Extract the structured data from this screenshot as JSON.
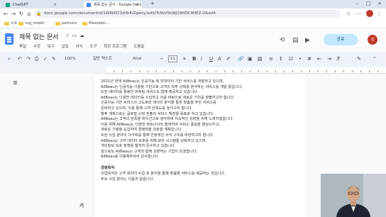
{
  "browser": {
    "tabs": [
      {
        "label": "ChatGPT",
        "favicon_color": "#10a37f"
      },
      {
        "label": "제목 없는 문서 - Google Docs",
        "favicon_color": "#4285f4"
      }
    ],
    "url": "docs.google.com/document/d/1W4kN73zHk4/Zgwcy/edit/TcfwV5kWJ19HOC4HEZ-U&edit",
    "bookmarks": [
      "노트",
      "nsg_model",
      "partners",
      "Mastodon..."
    ]
  },
  "docs": {
    "title": "제목 없는 문서",
    "menu": [
      "파일",
      "수정",
      "보기",
      "삽입",
      "서식",
      "도구",
      "확장 프로그램",
      "도움말"
    ],
    "zoom": "100%",
    "style": "일반 텍스트",
    "font": "Arial",
    "font_size": "11",
    "share_label": "공유",
    "avatar_initial": "김"
  },
  "content": {
    "lines": [
      "2021년 현재 AllBeau는 인공지능 및 빅데이터 기반 서비스를 개발하고 있으며,",
      "AllBeau는 인공지능 기술을 기반으로 고객의 피부 상태를 분석하는 서비스를 개발 중입니다.",
      "또한 데이터를 활용한 마케팅 서비스도 함께 제공하고 있습니다.",
      "AllBeau는 다양한 데이터를 수집하고 이를 바탕으로 새로운 가치를 창출하고자 합니다.",
      "인공지능 기반 서비스의 고도화와 데이터 분석을 통한 맞춤형 추천 서비스를",
      "준비하고 있으며, 이를 통해 고객 만족도를 높이고자 합니다.",
      "향후 계획으로는 글로벌 시장 진출과 서비스 확장을 목표로 하고 있습니다.",
      "AllBeau는 고객의 만족을 최우선으로 생각하며 지속적인 성장을 위해 노력하겠습니다.",
      "이를 위해 AllBeau는 다양한 파트너사와 협력하여 서비스 품질을 향상시키고,",
      "새로운 기술을 도입하여 경쟁력을 강화할 계획입니다.",
      "또한 사업 분야의 다각화를 통해 안정적인 수익 구조를 마련하고자 합니다.",
      "AllBeau는 고객 데이터 보호를 위해 보안 시스템을 강화하고 있으며,",
      "개인정보 보호 정책을 철저히 준수하고 있습니다.",
      "앞으로도 AllBeau는 고객과 함께 성장하는 기업이 되겠습니다.",
      "AllBeau를 이용해주셔서 감사합니다."
    ],
    "section_heading": "경영목적",
    "section_lines": [
      "사업목적은 고객 데이터 수집 및 분석을 통해 맞춤형 서비스를 제공하는 것입니다.",
      "주요 사업 분야는 다음과 같습니다."
    ]
  },
  "bottom_left_label": "카",
  "colors": {
    "accent": "#4285f4",
    "share": "#c2e7ff",
    "avatar": "#c0392b"
  }
}
